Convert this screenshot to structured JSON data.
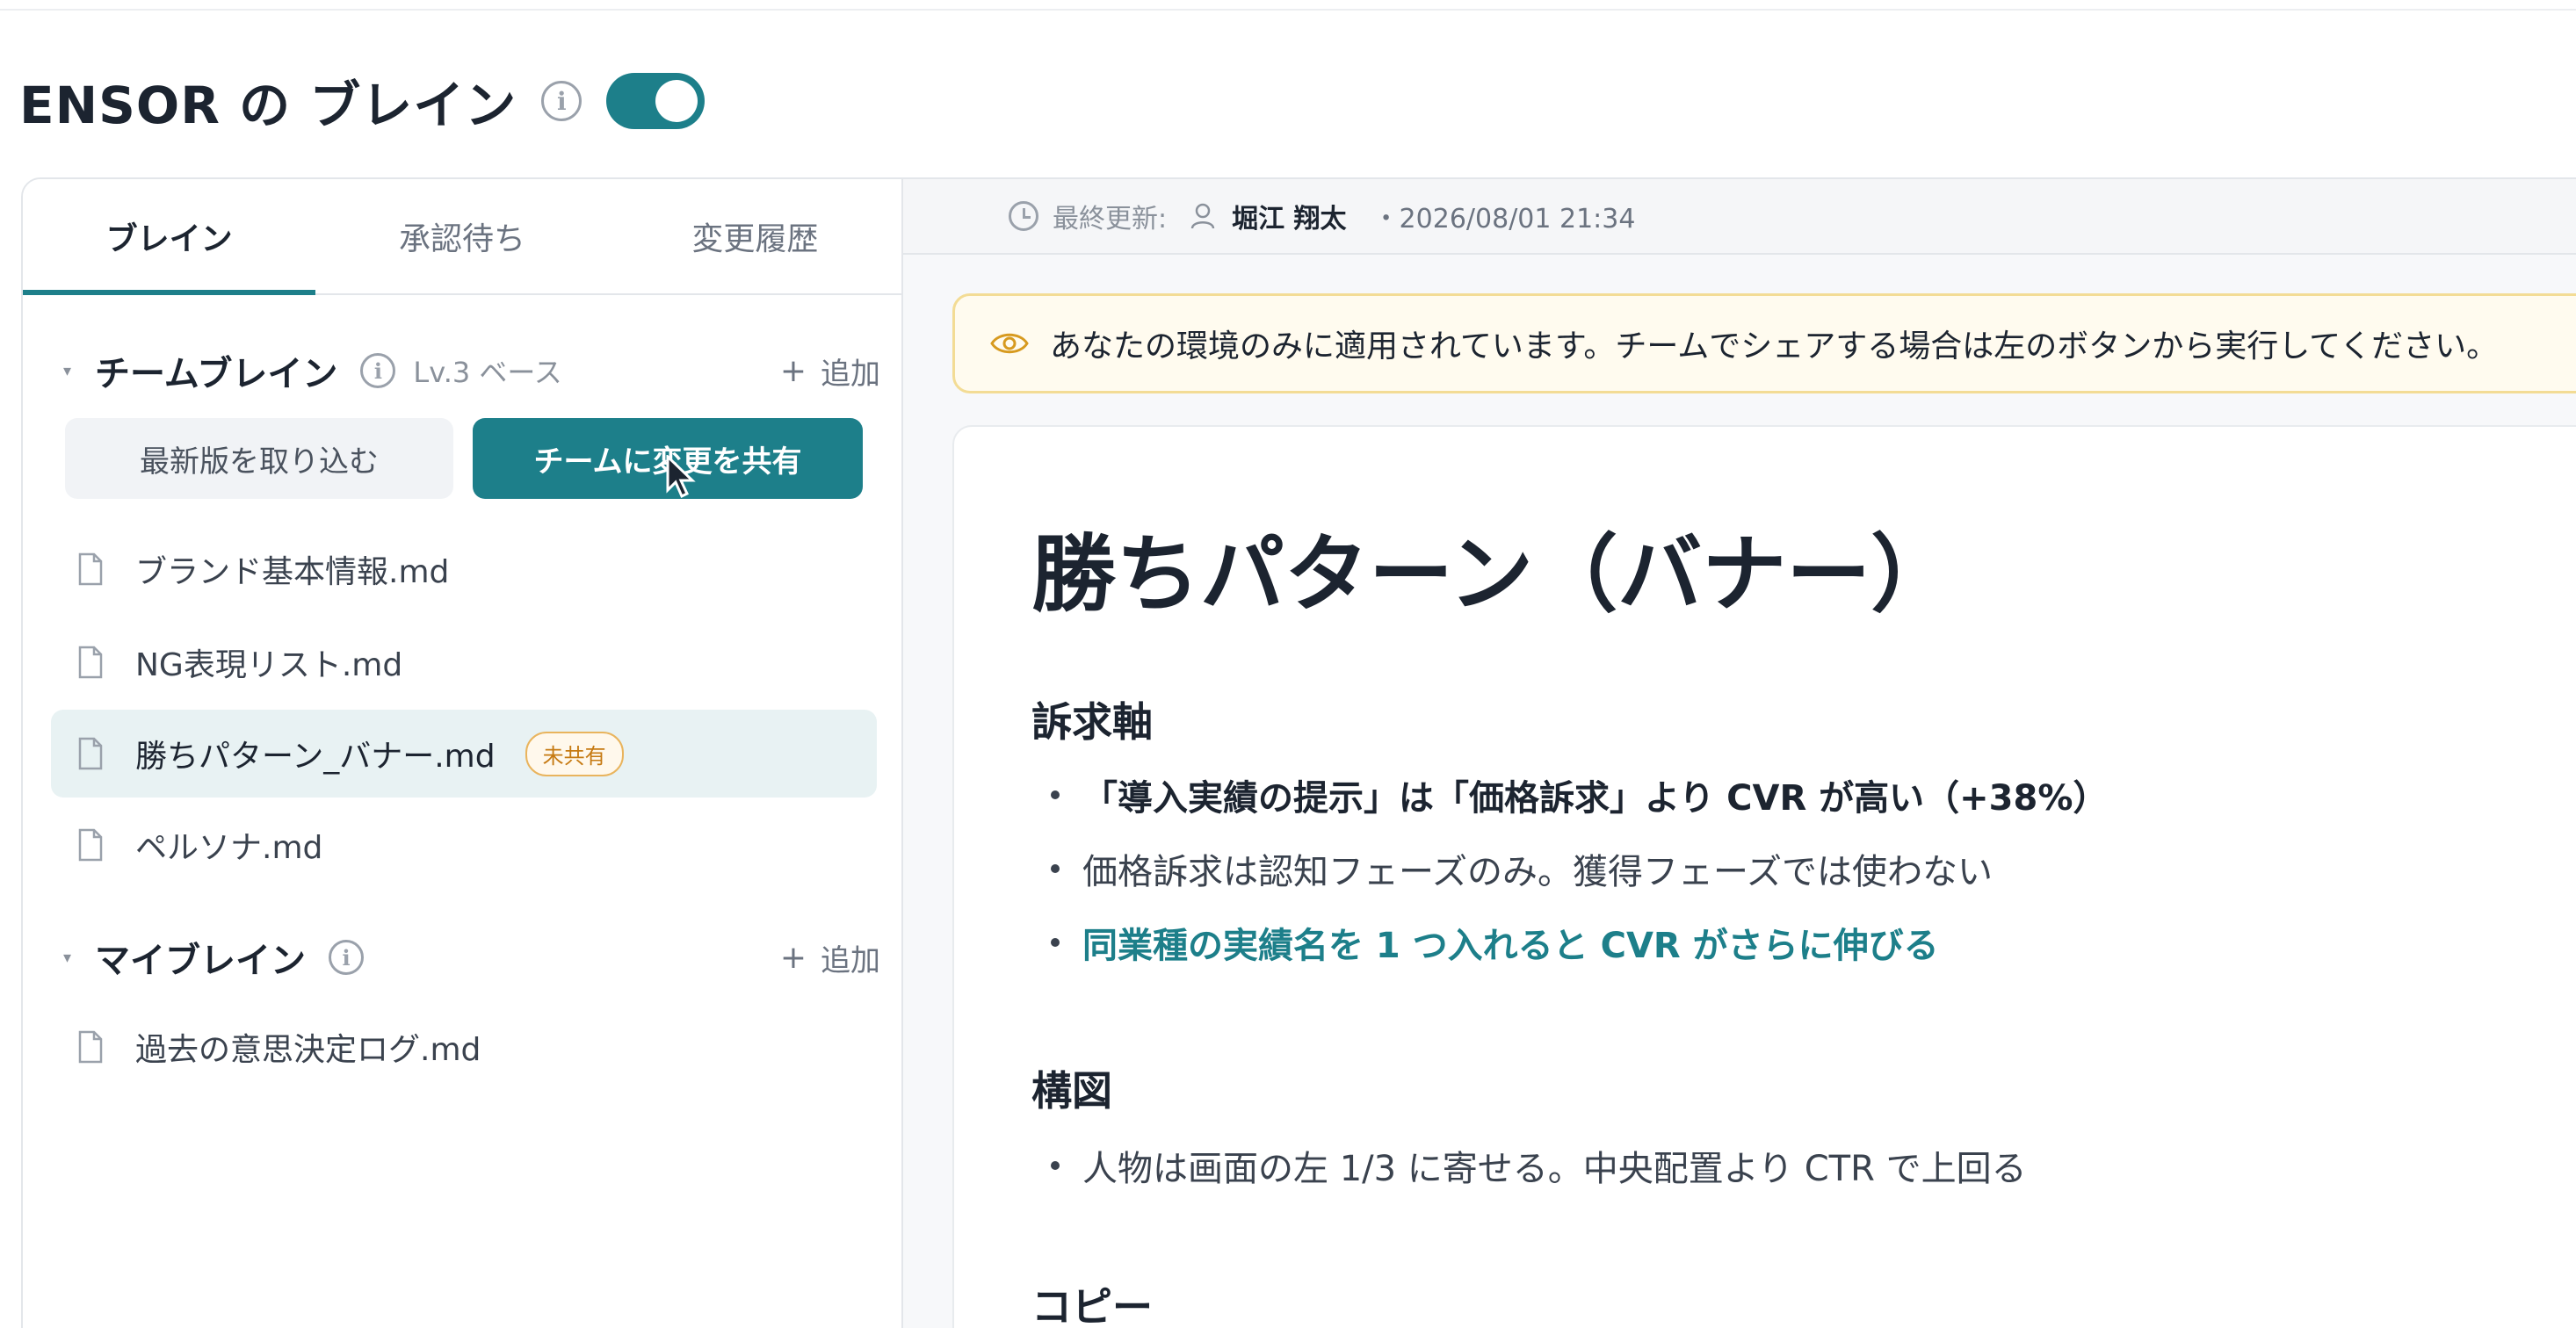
{
  "page": {
    "title": "ENSOR の ブレイン",
    "toggle_on": true
  },
  "tabs": [
    {
      "label": "ブレイン",
      "active": true
    },
    {
      "label": "承認待ち",
      "active": false
    },
    {
      "label": "変更履歴",
      "active": false
    }
  ],
  "team_brain": {
    "title": "チームブレイン",
    "level": "Lv.3 ベース",
    "add_label": "追加",
    "pull_label": "最新版を取り込む",
    "share_label": "チームに変更を共有",
    "files": [
      {
        "name": "ブランド基本情報.md"
      },
      {
        "name": "NG表現リスト.md"
      },
      {
        "name": "勝ちパターン_バナー.md",
        "selected": true,
        "badge": "未共有"
      },
      {
        "name": "ペルソナ.md"
      }
    ]
  },
  "my_brain": {
    "title": "マイブレイン",
    "add_label": "追加",
    "files": [
      {
        "name": "過去の意思決定ログ.md"
      }
    ]
  },
  "meta": {
    "label": "最終更新:",
    "user": "堀江 翔太",
    "date": "・2026/08/01 21:34"
  },
  "notice": {
    "text": "あなたの環境のみに適用されています。チームでシェアする場合は左のボタンから実行してください。"
  },
  "doc": {
    "title": "勝ちパターン（バナー）",
    "sections": [
      {
        "heading": "訴求軸",
        "bullets": [
          "「導入実績の提示」は「価格訴求」より CVR が高い（+38%）",
          "価格訴求は認知フェーズのみ。獲得フェーズでは使わない",
          "同業種の実績名を 1 つ入れると CVR がさらに伸びる"
        ]
      },
      {
        "heading": "構図",
        "bullets": [
          "人物は画面の左 1/3 に寄せる。中央配置より CTR で上回る"
        ]
      },
      {
        "heading": "コピー",
        "bullets": []
      }
    ]
  },
  "colors": {
    "accent": "#1d7f8a",
    "badge": "#c67a12",
    "notice_bg": "#fffbef"
  }
}
